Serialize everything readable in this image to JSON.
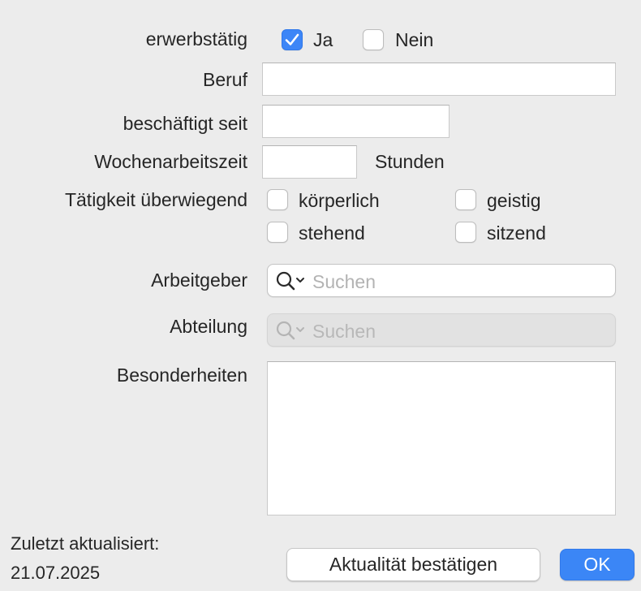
{
  "form": {
    "employed": {
      "label": "erwerbstätig",
      "yes_label": "Ja",
      "no_label": "Nein",
      "yes_checked": true,
      "no_checked": false
    },
    "job": {
      "label": "Beruf",
      "value": ""
    },
    "employed_since": {
      "label": "beschäftigt seit",
      "value": ""
    },
    "weekly_hours": {
      "label": "Wochenarbeitszeit",
      "value": "",
      "unit": "Stunden"
    },
    "activity": {
      "label": "Tätigkeit überwiegend",
      "options": [
        {
          "label": "körperlich",
          "checked": false
        },
        {
          "label": "geistig",
          "checked": false
        },
        {
          "label": "stehend",
          "checked": false
        },
        {
          "label": "sitzend",
          "checked": false
        }
      ]
    },
    "employer": {
      "label": "Arbeitgeber",
      "placeholder": "Suchen",
      "icon": "search-icon",
      "enabled": true
    },
    "department": {
      "label": "Abteilung",
      "placeholder": "Suchen",
      "icon": "search-icon",
      "enabled": false
    },
    "notes": {
      "label": "Besonderheiten",
      "value": ""
    }
  },
  "footer": {
    "last_updated_label": "Zuletzt aktualisiert:",
    "last_updated_date": "21.07.2025",
    "confirm_button": "Aktualität bestätigen",
    "ok_button": "OK"
  },
  "colors": {
    "accent": "#3b86f6",
    "background": "#ececec"
  }
}
